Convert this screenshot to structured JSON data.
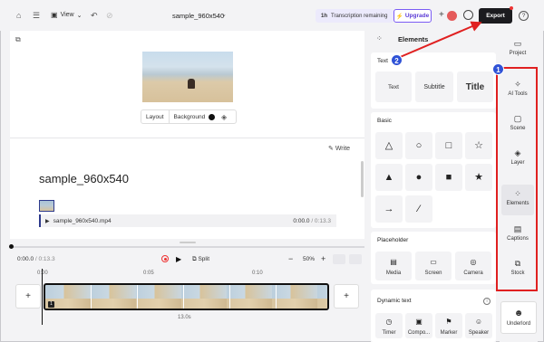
{
  "topbar": {
    "view_label": "View",
    "project_title": "sample_960x540",
    "transcription_count": "1h",
    "transcription_label": "Transcription remaining",
    "upgrade_label": "Upgrade",
    "export_label": "Export",
    "help_label": "?"
  },
  "canvas": {
    "layout_label": "Layout",
    "background_label": "Background",
    "write_label": "Write",
    "doc_title": "sample_960x540",
    "media_file": "sample_960x540.mp4",
    "media_current": "0:00.0",
    "media_total": "/ 0:13.3"
  },
  "timeline": {
    "current": "0:00.0",
    "total": "/ 0:13.3",
    "split_label": "Split",
    "zoom": "50%",
    "ruler": [
      "0:00",
      "0:05",
      "0:10"
    ],
    "clip_duration": "13.0s",
    "clip_badge": "1"
  },
  "panel": {
    "title": "Elements",
    "text_section": {
      "title": "Text",
      "items": [
        "Text",
        "Subtitle",
        "Title"
      ]
    },
    "basic_section": {
      "title": "Basic",
      "shapes": [
        "triangle-outline",
        "circle-outline",
        "square-outline",
        "star-outline",
        "triangle-filled",
        "circle-filled",
        "square-filled",
        "star-filled",
        "arrow",
        "line"
      ]
    },
    "placeholder_section": {
      "title": "Placeholder",
      "items": [
        "Media",
        "Screen",
        "Camera"
      ]
    },
    "dynamic_section": {
      "title": "Dynamic text",
      "items": [
        "Timer",
        "Compo...",
        "Marker",
        "Speaker"
      ]
    }
  },
  "sidebar": {
    "items": [
      "Project",
      "AI Tools",
      "Scene",
      "Layer",
      "Elements",
      "Captions",
      "Stock"
    ],
    "underlord": "Underlord"
  },
  "callouts": [
    "1",
    "2"
  ],
  "colors": {
    "accent_red": "#e02020",
    "callout_blue": "#2f52d6",
    "upgrade_purple": "#7b5cf5"
  }
}
